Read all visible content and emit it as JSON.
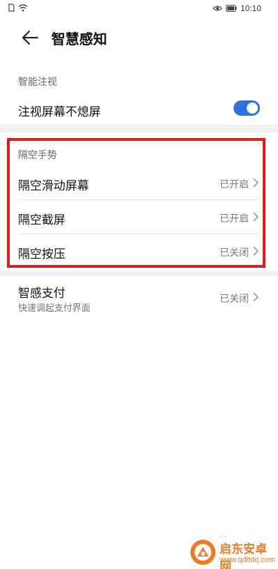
{
  "status_bar": {
    "time": "10:10"
  },
  "header": {
    "title": "智慧感知"
  },
  "sections": {
    "gaze": {
      "label": "智能注视",
      "row": {
        "title": "注视屏幕不熄屏",
        "toggle_on": true
      }
    },
    "air_gesture": {
      "label": "隔空手势",
      "rows": [
        {
          "title": "隔空滑动屏幕",
          "value": "已开启"
        },
        {
          "title": "隔空截屏",
          "value": "已开启"
        },
        {
          "title": "隔空按压",
          "value": "已关闭"
        }
      ]
    },
    "smart_pay": {
      "title": "智感支付",
      "subtitle": "快速调起支付界面",
      "value": "已关闭"
    }
  },
  "annotation": {
    "highlight_color": "#d91d1d"
  },
  "colors": {
    "toggle_accent": "#2a73dc",
    "watermark": "#f07a23"
  },
  "watermark": {
    "name": "启东安卓网",
    "url": "www.qdltdq.com"
  }
}
